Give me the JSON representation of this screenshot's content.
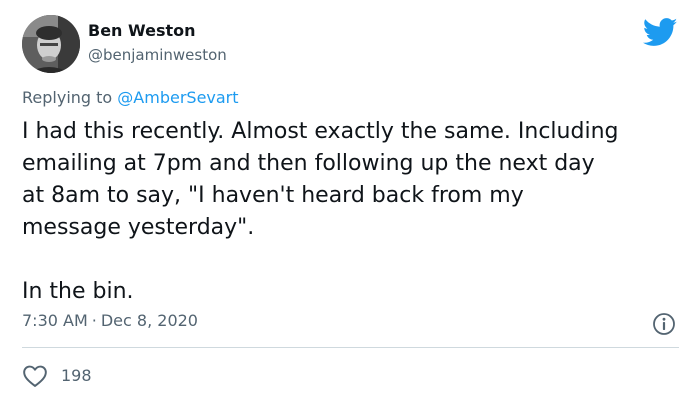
{
  "author": {
    "name": "Ben Weston",
    "handle": "@benjaminweston"
  },
  "reply": {
    "prefix": "Replying to ",
    "handle": "@AmberSevart"
  },
  "tweet": {
    "paragraph_1": "I had this recently. Almost exactly the same. Including\nemailing at 7pm and then following up the next day\nat 8am to say, \"I haven't heard back from my\nmessage yesterday\".",
    "paragraph_2": "In the bin.",
    "time": "7:30 AM",
    "separator": "·",
    "date": "Dec 8, 2020"
  },
  "stats": {
    "likes": "198"
  },
  "icons": {
    "brand": "twitter-bird-icon",
    "info": "info-icon",
    "like": "heart-icon"
  },
  "colors": {
    "brand_blue": "#1d9bf0",
    "text_primary": "#0f1419",
    "text_secondary": "#536471",
    "divider": "#cfd9de"
  }
}
